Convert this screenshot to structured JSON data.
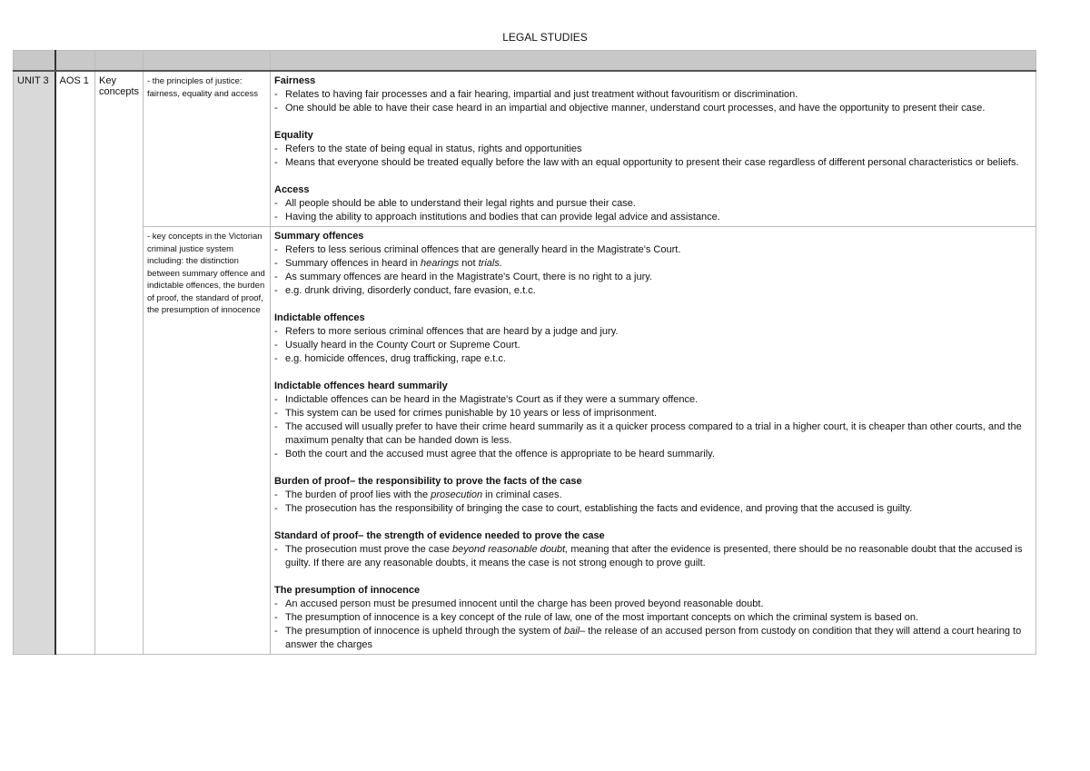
{
  "title": "LEGAL STUDIES",
  "row": {
    "unit": "UNIT 3",
    "aos": "AOS 1",
    "topic": "Key concepts"
  },
  "rows": [
    {
      "point": "- the principles of justice: fairness, equality and access",
      "sections": [
        {
          "heading": "Fairness",
          "bullets": [
            [
              {
                "t": "Relates to having fair processes and a fair hearing, impartial and just treatment without favouritism or discrimination."
              }
            ],
            [
              {
                "t": "One should be able to have their case heard in an impartial and objective manner, understand court processes, and have the opportunity to present their case."
              }
            ]
          ]
        },
        {
          "heading": "Equality",
          "bullets": [
            [
              {
                "t": "Refers to the state of being equal in status, rights and opportunities"
              }
            ],
            [
              {
                "t": "Means that everyone should be treated equally before the law with an equal opportunity to present their case regardless of different personal characteristics or beliefs."
              }
            ]
          ]
        },
        {
          "heading": "Access",
          "bullets": [
            [
              {
                "t": "All people should be able to understand their legal rights and pursue their case."
              }
            ],
            [
              {
                "t": "Having the ability to approach institutions and bodies that can provide legal advice and assistance."
              }
            ]
          ]
        }
      ]
    },
    {
      "point": "- key concepts in the Victorian criminal justice system including: the distinction between summary offence and indictable offences, the burden of proof, the standard of proof, the presumption of innocence",
      "sections": [
        {
          "heading": "Summary offences",
          "bullets": [
            [
              {
                "t": "Refers to less serious criminal offences that are generally heard in the Magistrate's Court."
              }
            ],
            [
              {
                "t": "Summary offences in heard in "
              },
              {
                "t": "hearings",
                "i": true
              },
              {
                "t": " not "
              },
              {
                "t": "trials.",
                "i": true
              }
            ],
            [
              {
                "t": "As summary offences are heard in the Magistrate's Court, there is no right to a jury."
              }
            ],
            [
              {
                "t": "e.g. drunk driving, disorderly conduct, fare evasion, e.t.c."
              }
            ]
          ]
        },
        {
          "heading": "Indictable offences",
          "bullets": [
            [
              {
                "t": "Refers to more serious criminal offences that are heard by a judge and jury."
              }
            ],
            [
              {
                "t": "Usually heard in the County Court or Supreme Court."
              }
            ],
            [
              {
                "t": "e.g. homicide offences, drug trafficking, rape e.t.c."
              }
            ]
          ]
        },
        {
          "heading": "Indictable offences heard summarily",
          "bullets": [
            [
              {
                "t": "Indictable offences can be heard in the Magistrate's Court as if they were a summary offence."
              }
            ],
            [
              {
                "t": "This system can be used for crimes punishable by 10 years or less of imprisonment."
              }
            ],
            [
              {
                "t": "The accused will usually prefer to have their crime heard summarily as it a quicker process compared to a trial in a higher court, it is cheaper than other courts, and the maximum penalty that can be handed down is less."
              }
            ],
            [
              {
                "t": "Both the court and the accused must agree that the offence is appropriate to be heard summarily."
              }
            ]
          ]
        },
        {
          "heading": "Burden of proof– the responsibility to prove the facts of the case",
          "bullets": [
            [
              {
                "t": "The burden of proof lies with the "
              },
              {
                "t": "prosecution",
                "i": true
              },
              {
                "t": " in criminal cases."
              }
            ],
            [
              {
                "t": "The prosecution has the responsibility of bringing the case to court, establishing the facts and evidence, and proving that the accused is guilty."
              }
            ]
          ]
        },
        {
          "heading": "Standard of proof– the strength of evidence needed to prove the case",
          "bullets": [
            [
              {
                "t": "The prosecution must prove the case "
              },
              {
                "t": "beyond reasonable doubt,",
                "i": true
              },
              {
                "t": " meaning that after the evidence is presented, there should be no reasonable doubt that the accused is guilty. If there are any reasonable doubts, it means the case is not strong enough to prove guilt."
              }
            ]
          ]
        },
        {
          "heading": "The presumption of innocence",
          "bullets": [
            [
              {
                "t": "An accused person must be presumed innocent until the charge has been proved beyond reasonable doubt."
              }
            ],
            [
              {
                "t": "The presumption of innocence is a key concept of the rule of law, one of the most important concepts on which the criminal system is based on."
              }
            ],
            [
              {
                "t": "The presumption of innocence is upheld through the system of "
              },
              {
                "t": "bail",
                "i": true
              },
              {
                "t": "– the release of an accused person from custody on condition that they will attend a court hearing to answer the charges"
              }
            ]
          ]
        }
      ]
    }
  ]
}
